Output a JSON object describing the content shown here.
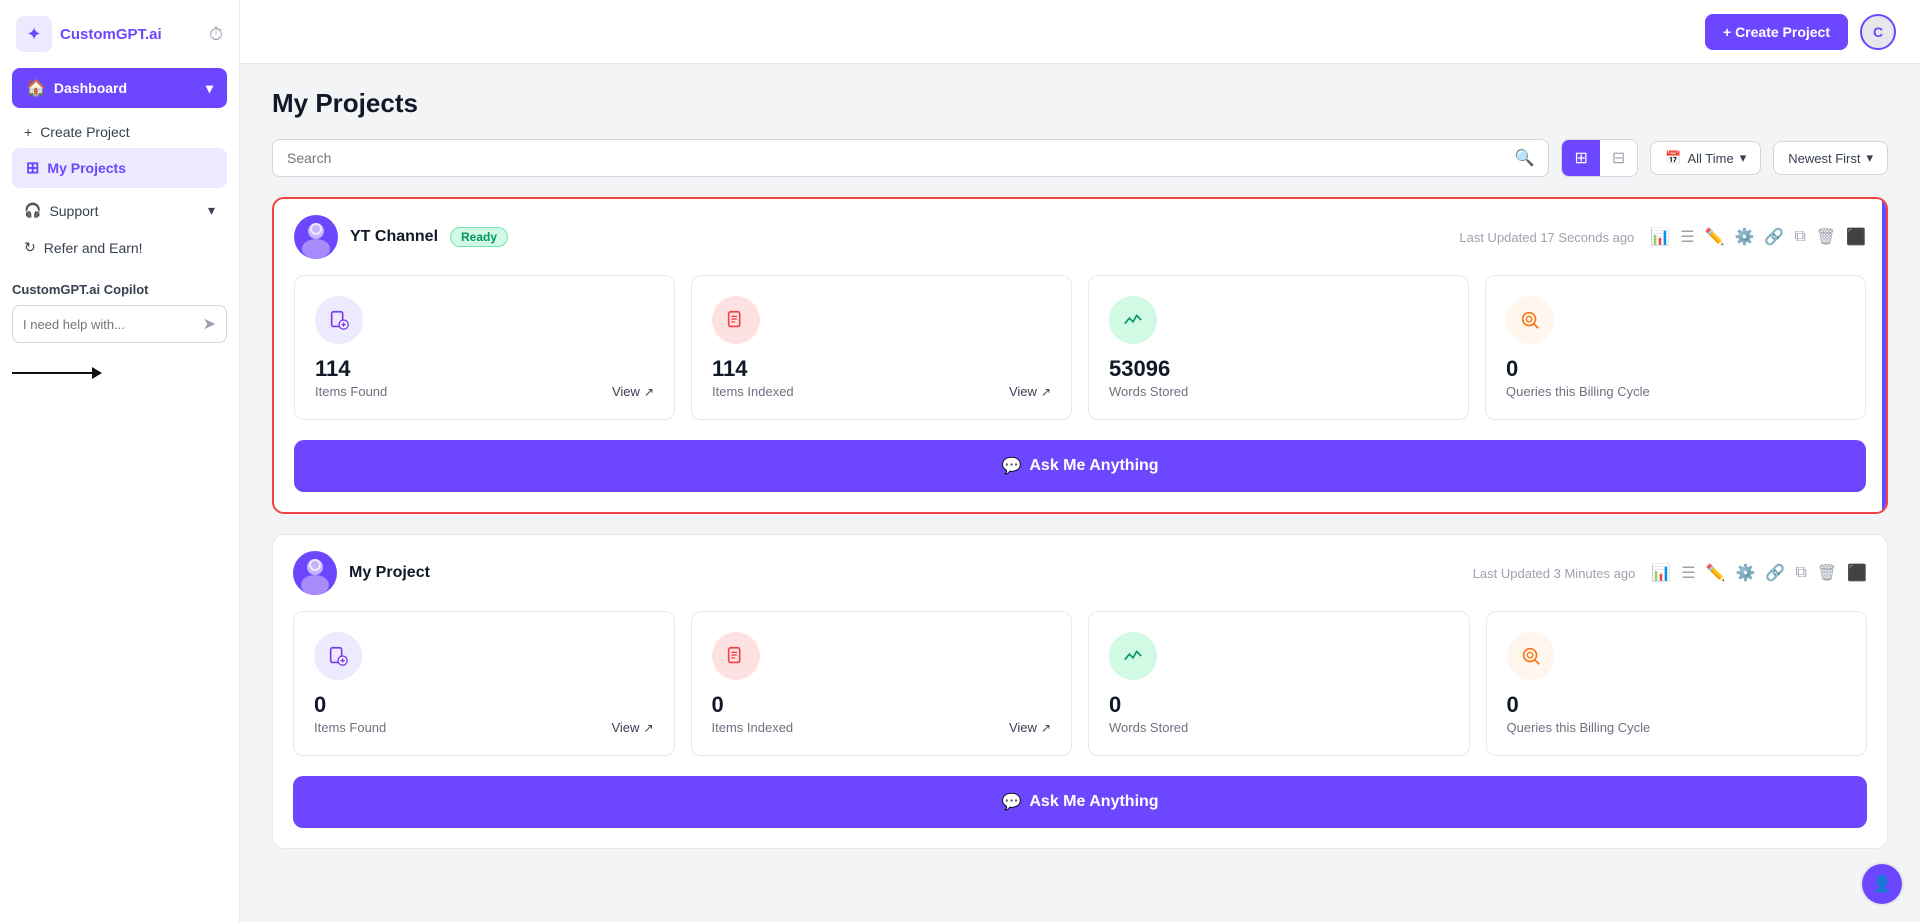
{
  "app": {
    "name": "CustomGPT.ai",
    "logo_text": "CustomGPT.ai"
  },
  "topbar": {
    "create_project_label": "+ Create Project",
    "avatar_letter": "C"
  },
  "sidebar": {
    "dashboard_label": "Dashboard",
    "create_project_label": "Create Project",
    "my_projects_label": "My Projects",
    "support_label": "Support",
    "refer_label": "Refer and Earn!",
    "copilot_label": "CustomGPT.ai Copilot",
    "copilot_placeholder": "I need help with..."
  },
  "page": {
    "title": "My Projects",
    "search_placeholder": "Search"
  },
  "filters": {
    "time_label": "All Time",
    "sort_label": "Newest First"
  },
  "projects": [
    {
      "name": "YT Channel",
      "badge": "Ready",
      "last_updated": "Last Updated 17 Seconds ago",
      "highlighted": true,
      "stats": [
        {
          "number": "114",
          "label": "Items Found",
          "show_view": true,
          "icon_type": "purple",
          "icon": "📄"
        },
        {
          "number": "114",
          "label": "Items Indexed",
          "show_view": true,
          "icon_type": "red",
          "icon": "📋"
        },
        {
          "number": "53096",
          "label": "Words Stored",
          "show_view": false,
          "icon_type": "green",
          "icon": "📈"
        },
        {
          "number": "0",
          "label": "Queries this Billing Cycle",
          "show_view": false,
          "icon_type": "orange",
          "icon": "🔍"
        }
      ],
      "ask_label": "Ask Me Anything"
    },
    {
      "name": "My Project",
      "badge": null,
      "last_updated": "Last Updated 3 Minutes ago",
      "highlighted": false,
      "stats": [
        {
          "number": "0",
          "label": "Items Found",
          "show_view": true,
          "icon_type": "purple",
          "icon": "📄"
        },
        {
          "number": "0",
          "label": "Items Indexed",
          "show_view": true,
          "icon_type": "red",
          "icon": "📋"
        },
        {
          "number": "0",
          "label": "Words Stored",
          "show_view": false,
          "icon_type": "green",
          "icon": "📈"
        },
        {
          "number": "0",
          "label": "Queries this Billing Cycle",
          "show_view": false,
          "icon_type": "orange",
          "icon": "🔍"
        }
      ],
      "ask_label": "Ask Me Anything"
    }
  ],
  "view": {
    "view_label": "View"
  }
}
